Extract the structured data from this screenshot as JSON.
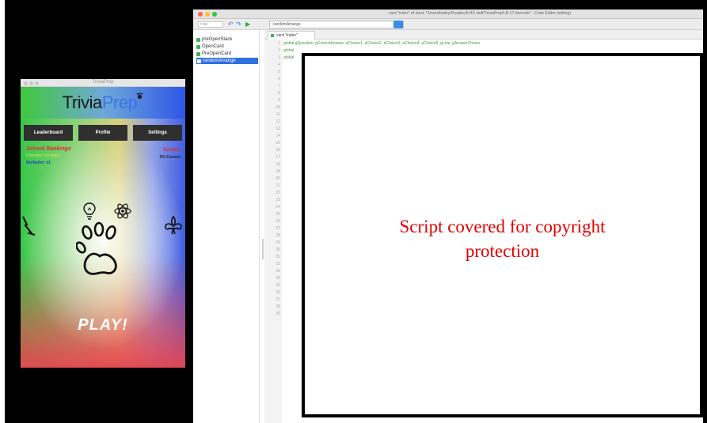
{
  "phone": {
    "window_title": "TriviaPrep",
    "logo_part1": "Trivia",
    "logo_part2": "Prep",
    "nav": [
      "Leaderboard",
      "Profile",
      "Settings"
    ],
    "rank_title": "School Rankings",
    "rank_sub": "Choctaw: 1st place",
    "multiplier": "Multiplier: x1",
    "scores_title": "Scores:",
    "scores_sub": "0% Correct",
    "play_label": "PLAY!"
  },
  "editor": {
    "window_title": "card \"index\" of stack \"/Users/bailey/Dropbox/LHS stuff/TriviaPrep/LB-17.livecode\" - Code Editor (editing)",
    "filter_placeholder": "Filter",
    "handler": "randomArrange",
    "scripts": [
      "preOpenStack",
      "OpenCard",
      "PreOpenCard",
      "randomArrange"
    ],
    "selected_script_index": 3,
    "tab_label": "card \"index\"",
    "code_lines": [
      "global gQuestion, gCorrectAnswer, aChoice1, aChoice2, aChoice3, aChoice4, aChoice5, gLine, gAnswerChoice",
      "global",
      "global"
    ],
    "line_numbers": [
      "1",
      "2",
      "3",
      "4",
      "5",
      "6",
      "7",
      "8",
      "9",
      "10",
      "11",
      "12",
      "13",
      "14",
      "15",
      "16",
      "17",
      "18",
      "19",
      "20",
      "21",
      "22",
      "23",
      "24",
      "25",
      "26",
      "27",
      "28",
      "29",
      "30",
      "31",
      "32",
      "33",
      "34",
      "35",
      "36",
      "37",
      "38",
      "39"
    ],
    "overlay_text_1": "Script covered for copyright",
    "overlay_text_2": "protection"
  },
  "colors": {
    "accent_blue": "#2f6fe0",
    "overlay_text": "#e00000",
    "code_green": "#3c9a3c"
  }
}
